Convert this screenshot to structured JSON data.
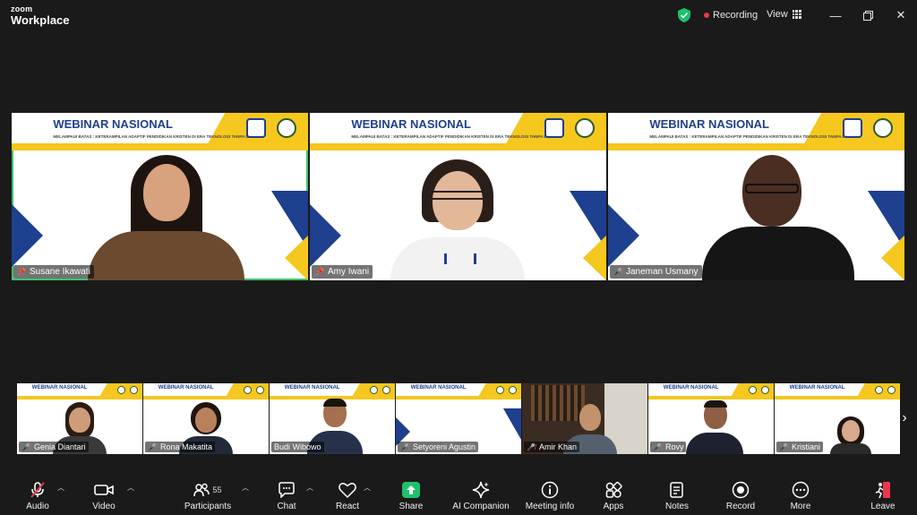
{
  "app": {
    "logo_top": "zoom",
    "logo_bottom": "Workplace"
  },
  "titlebar": {
    "recording": "Recording",
    "view": "View"
  },
  "banner": {
    "title": "WEBINAR NASIONAL",
    "subtitle": "MELAMPAUI BATAS : KETERAMPILAN ADAPTIF PENDIDIKAN KRISTEN DI ERA TEKNOLOGI TANPA BATAS"
  },
  "main_tiles": [
    {
      "name": "Susane Ikawati",
      "pinned": true,
      "active_speaker": true
    },
    {
      "name": "Amy Iwani",
      "pinned": true,
      "active_speaker": false
    },
    {
      "name": "Janeman Usmany",
      "pinned": false,
      "muted": true,
      "active_speaker": false
    }
  ],
  "filmstrip": [
    {
      "name": "Genia Diantari",
      "muted": true
    },
    {
      "name": "Rona Makatita",
      "muted": true
    },
    {
      "name": "Budi Wibowo",
      "muted": false
    },
    {
      "name": "Setyoreni Agustin",
      "muted": true
    },
    {
      "name": "Amir Khan",
      "muted": true
    },
    {
      "name": "Rovy",
      "muted": true
    },
    {
      "name": "Kristiani",
      "muted": true
    }
  ],
  "toolbar": {
    "audio": "Audio",
    "video": "Video",
    "participants": "Participants",
    "participants_count": "55",
    "chat": "Chat",
    "react": "React",
    "share": "Share",
    "ai_companion": "AI Companion",
    "meeting_info": "Meeting info",
    "apps": "Apps",
    "notes": "Notes",
    "record": "Record",
    "more": "More",
    "leave": "Leave"
  },
  "colors": {
    "share_green": "#1fc16b",
    "leave_red": "#e8384f",
    "active_speaker": "#3cc46a",
    "banner_yellow": "#f6c71e",
    "banner_blue": "#1f3f8f"
  }
}
